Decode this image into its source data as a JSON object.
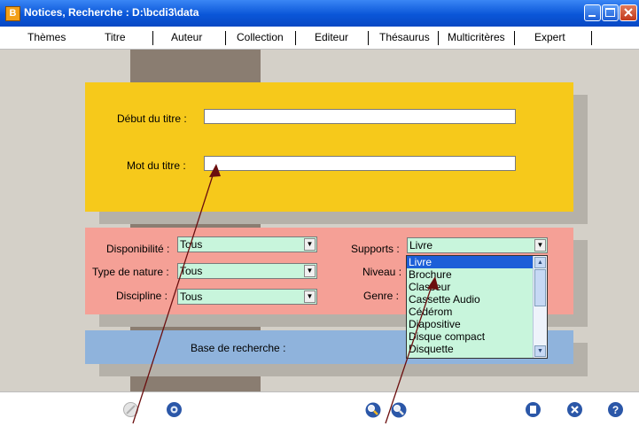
{
  "window": {
    "title": "Notices, Recherche : D:\\bcdi3\\data",
    "app_icon": "B"
  },
  "tabs": [
    "Thèmes",
    "Titre",
    "Auteur",
    "Collection",
    "Editeur",
    "Thésaurus",
    "Multicritères",
    "Expert"
  ],
  "title_search": {
    "debut_label": "Début du titre :",
    "debut_value": "",
    "mot_label": "Mot du titre :",
    "mot_value": ""
  },
  "filters": {
    "disponibilite_label": "Disponibilité :",
    "disponibilite_value": "Tous",
    "type_label": "Type de nature :",
    "type_value": "Tous",
    "discipline_label": "Discipline :",
    "discipline_value": "Tous",
    "supports_label": "Supports :",
    "supports_value": "Livre",
    "niveau_label": "Niveau :",
    "genre_label": "Genre :"
  },
  "supports_options": [
    "Livre",
    "Brochure",
    "Classeur",
    "Cassette Audio",
    "Cédérom",
    "Diapositive",
    "Disque compact",
    "Disquette"
  ],
  "base": {
    "label": "Base de recherche :"
  },
  "toolbar_icons": [
    "disabled-circle-icon",
    "gear-icon",
    "search-add-icon",
    "search-refresh-icon",
    "notes-icon",
    "close-circle-icon",
    "help-icon"
  ],
  "colors": {
    "yellow_panel": "#f6c91b",
    "pink_panel": "#f5a096",
    "blue_panel": "#8fb3dc",
    "dropdown_bg": "#c8f5dc",
    "titlebar": "#0a56d8",
    "annotation_arrow": "#6b0f0f"
  }
}
